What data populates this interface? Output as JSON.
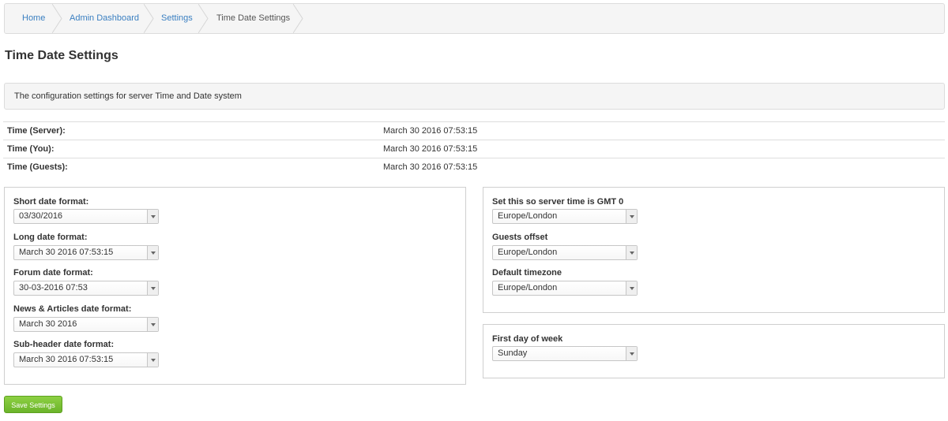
{
  "breadcrumb": {
    "items": [
      {
        "label": "Home"
      },
      {
        "label": "Admin Dashboard"
      },
      {
        "label": "Settings"
      },
      {
        "label": "Time Date Settings"
      }
    ]
  },
  "page": {
    "title": "Time Date Settings",
    "description": "The configuration settings for server Time and Date system"
  },
  "times": [
    {
      "label": "Time (Server):",
      "value": "March 30 2016 07:53:15"
    },
    {
      "label": "Time (You):",
      "value": "March 30 2016 07:53:15"
    },
    {
      "label": "Time (Guests):",
      "value": "March 30 2016 07:53:15"
    }
  ],
  "date_formats": {
    "short": {
      "label": "Short date format:",
      "value": "03/30/2016"
    },
    "long": {
      "label": "Long date format:",
      "value": "March 30 2016 07:53:15"
    },
    "forum": {
      "label": "Forum date format:",
      "value": "30-03-2016 07:53"
    },
    "news": {
      "label": "News & Articles date format:",
      "value": "March 30 2016"
    },
    "subheader": {
      "label": "Sub-header date format:",
      "value": "March 30 2016 07:53:15"
    }
  },
  "timezones": {
    "server": {
      "label": "Set this so server time is GMT 0",
      "value": "Europe/London"
    },
    "guests": {
      "label": "Guests offset",
      "value": "Europe/London"
    },
    "default": {
      "label": "Default timezone",
      "value": "Europe/London"
    }
  },
  "week": {
    "first_day": {
      "label": "First day of week",
      "value": "Sunday"
    }
  },
  "actions": {
    "save_label": "Save Settings"
  },
  "colors": {
    "link": "#3a7fc1",
    "save_button": "#7cc236",
    "panel_border": "#cfcfcf"
  }
}
